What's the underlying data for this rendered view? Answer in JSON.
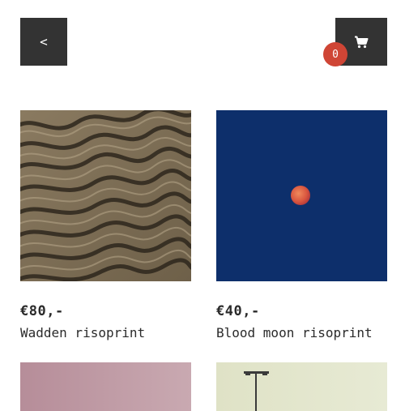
{
  "nav": {
    "back_label": "<"
  },
  "cart": {
    "icon": "cart-icon",
    "count": "0"
  },
  "colors": {
    "dark_button": "#333333",
    "badge": "#cf4535"
  },
  "products": [
    {
      "price": "€80,-",
      "title": "Wadden risoprint",
      "image": "sand-ripples"
    },
    {
      "price": "€40,-",
      "title": "Blood moon risoprint",
      "image": "red-moon-blue-sky"
    },
    {
      "image": "pink-sky"
    },
    {
      "image": "street-lamp-pale-sky"
    }
  ]
}
